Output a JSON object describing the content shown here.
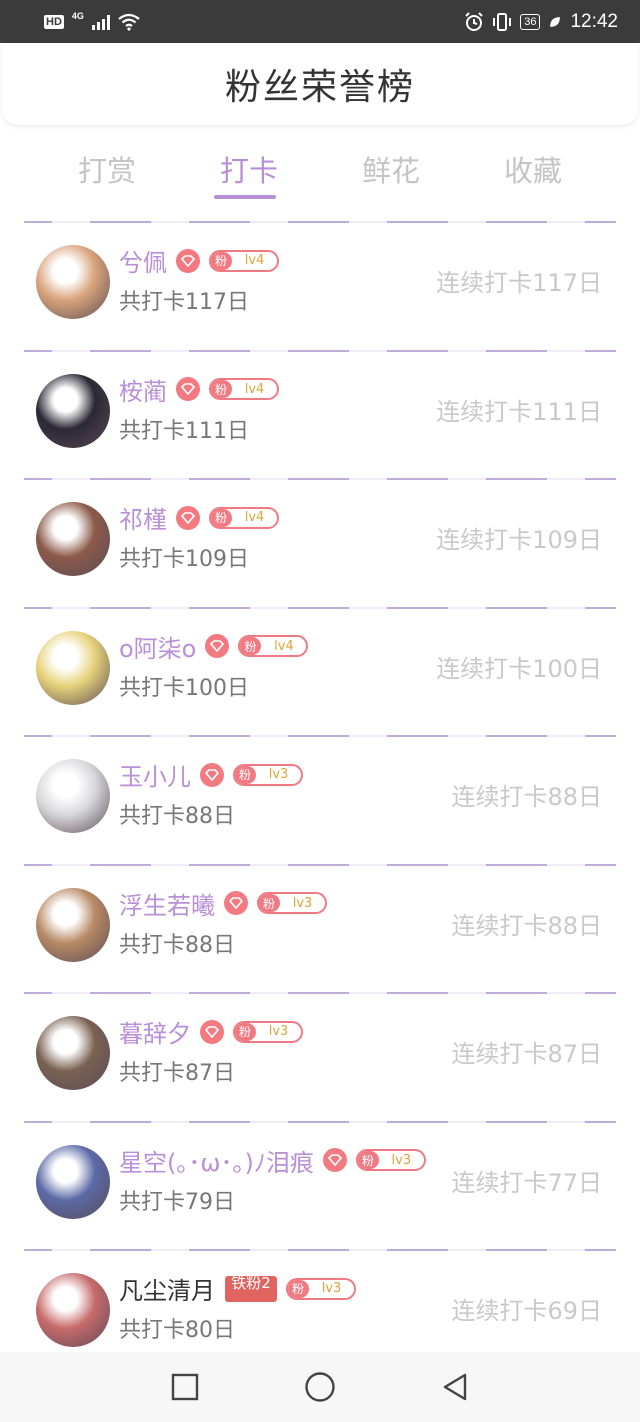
{
  "status_bar": {
    "hd": "HD",
    "network": "4G",
    "battery": "36",
    "time": "12:42"
  },
  "header": {
    "title": "粉丝荣誉榜"
  },
  "tabs": [
    {
      "label": "打赏",
      "active": false
    },
    {
      "label": "打卡",
      "active": true
    },
    {
      "label": "鲜花",
      "active": false
    },
    {
      "label": "收藏",
      "active": false
    }
  ],
  "fans": [
    {
      "name": "兮佩",
      "badge_label": "粉",
      "level": "lv4",
      "total": "共打卡117日",
      "streak": "连续打卡117日",
      "avatar_color": "#d9a47c"
    },
    {
      "name": "桉蔺",
      "badge_label": "粉",
      "level": "lv4",
      "total": "共打卡111日",
      "streak": "连续打卡111日",
      "avatar_color": "#2b2836"
    },
    {
      "name": "祁槿",
      "badge_label": "粉",
      "level": "lv4",
      "total": "共打卡109日",
      "streak": "连续打卡109日",
      "avatar_color": "#8c5a4a"
    },
    {
      "name": "o阿柒o",
      "badge_label": "粉",
      "level": "lv4",
      "total": "共打卡100日",
      "streak": "连续打卡100日",
      "avatar_color": "#e6d27a"
    },
    {
      "name": "玉小儿",
      "badge_label": "粉",
      "level": "lv3",
      "total": "共打卡88日",
      "streak": "连续打卡88日",
      "avatar_color": "#d9d9dc"
    },
    {
      "name": "浮生若曦",
      "badge_label": "粉",
      "level": "lv3",
      "total": "共打卡88日",
      "streak": "连续打卡88日",
      "avatar_color": "#b98a66"
    },
    {
      "name": "暮辞夕",
      "badge_label": "粉",
      "level": "lv3",
      "total": "共打卡87日",
      "streak": "连续打卡87日",
      "avatar_color": "#7a6252"
    },
    {
      "name": "星空(｡･ω･｡)ﾉ泪痕",
      "badge_label": "粉",
      "level": "lv3",
      "total": "共打卡79日",
      "streak": "连续打卡77日",
      "avatar_color": "#5b6aa6"
    },
    {
      "name": "凡尘清月",
      "plain": true,
      "iron_badge": "铁粉2",
      "badge_label": "粉",
      "level": "lv3",
      "total": "共打卡80日",
      "streak": "连续打卡69日",
      "avatar_color": "#c76b6b"
    }
  ],
  "nav": {
    "recent": "square-icon",
    "home": "circle-icon",
    "back": "triangle-back-icon"
  }
}
